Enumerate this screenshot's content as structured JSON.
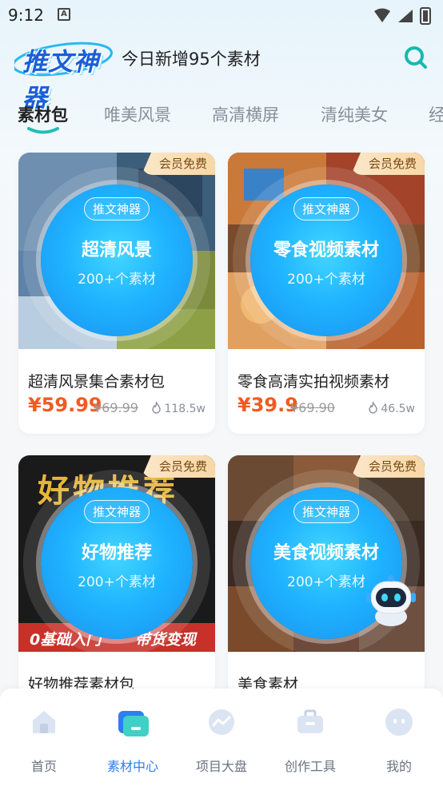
{
  "status_bar": {
    "time": "9:12",
    "notification_glyph": "A"
  },
  "header": {
    "logo_text": "推文神器",
    "title": "今日新增95个素材"
  },
  "tabs": [
    {
      "label": "素材包",
      "active": true
    },
    {
      "label": "唯美风景",
      "active": false
    },
    {
      "label": "高清横屏",
      "active": false
    },
    {
      "label": "清纯美女",
      "active": false
    },
    {
      "label": "经",
      "active": false
    }
  ],
  "cards": [
    {
      "badge": "会员免费",
      "pill": "推文神器",
      "ring_title": "超清风景",
      "ring_sub": "200+个素材",
      "name": "超清风景集合素材包",
      "price": "¥59.99",
      "old_price": "¥69.99",
      "views": "118.5w"
    },
    {
      "badge": "会员免费",
      "pill": "推文神器",
      "ring_title": "零食视频素材",
      "ring_sub": "200+个素材",
      "name": "零食高清实拍视频素材",
      "price": "¥39.9",
      "old_price": "¥69.90",
      "views": "46.5w"
    },
    {
      "badge": "会员免费",
      "pill": "推文神器",
      "ring_title": "好物推荐",
      "ring_sub": "200+个素材",
      "name": "好物推荐素材包",
      "banner_top": "好物推荐",
      "banner_bottom_left": "0基础入门",
      "banner_bottom_right": "带货变现"
    },
    {
      "badge": "会员免费",
      "pill": "推文神器",
      "ring_title": "美食视频素材",
      "ring_sub": "200+个素材",
      "name": "美食素材"
    }
  ],
  "bottom_nav": [
    {
      "label": "首页",
      "icon": "home-icon",
      "active": false
    },
    {
      "label": "素材中心",
      "icon": "folder-icon",
      "active": true
    },
    {
      "label": "项目大盘",
      "icon": "chart-icon",
      "active": false
    },
    {
      "label": "创作工具",
      "icon": "toolbox-icon",
      "active": false
    },
    {
      "label": "我的",
      "icon": "profile-icon",
      "active": false
    }
  ],
  "colors": {
    "accent": "#2d7df5",
    "price": "#f25a22",
    "teal": "#1fbfb8",
    "badge_bg": "#f7d7a6"
  }
}
